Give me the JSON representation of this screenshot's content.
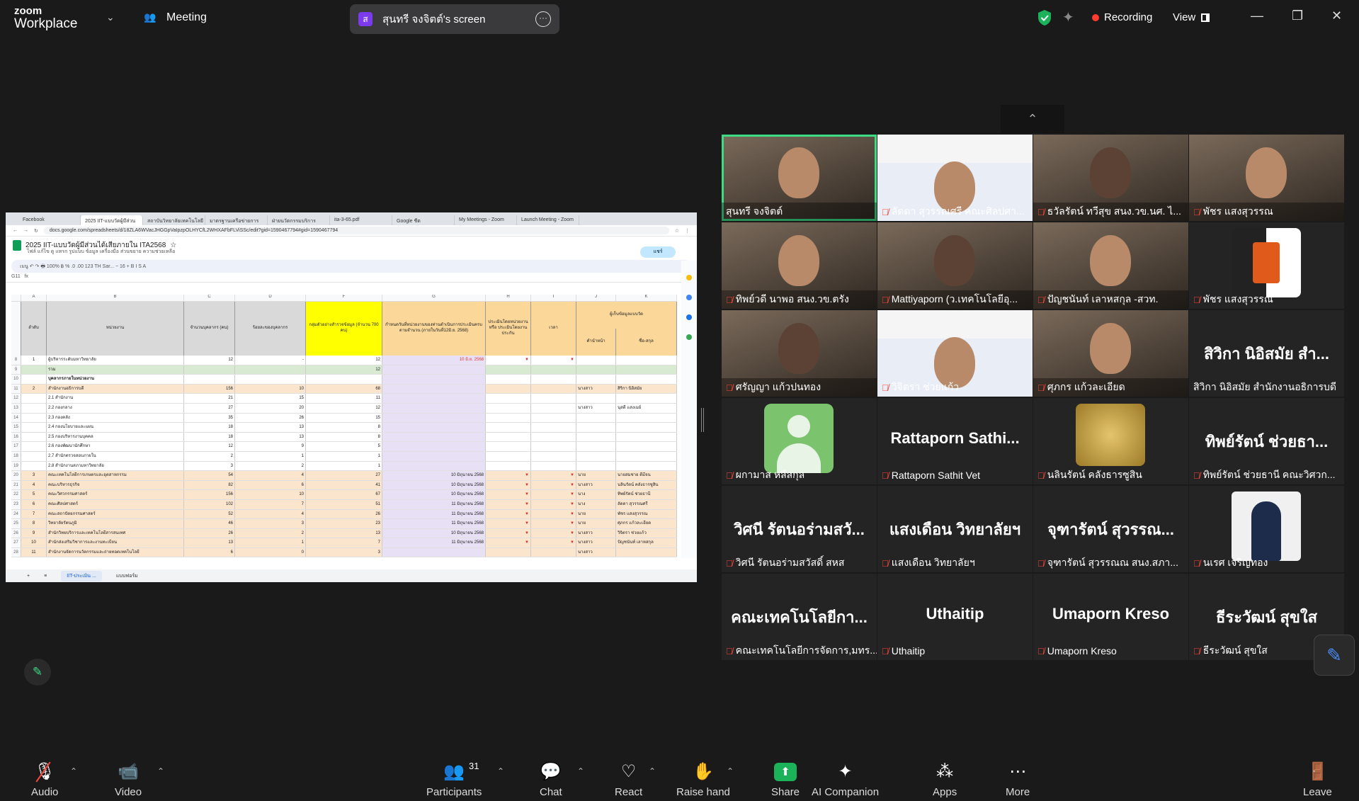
{
  "app": {
    "brand_top": "zoom",
    "brand_bottom": "Workplace",
    "meeting_label": "Meeting"
  },
  "screen_share": {
    "avatar_letter": "ส",
    "label": "สุนทรี จงจิตต์'s screen"
  },
  "status": {
    "recording": "Recording",
    "view": "View",
    "colors": {
      "recording": "#ff3b30",
      "shield": "#1cb25a",
      "active_speaker": "#3ddc84"
    }
  },
  "browser": {
    "tabs": [
      "Facebook",
      "2025 IIT-แบบวัดผู้มีส่วน",
      "สถาบันวิทยาลัยเทคโนโลยี",
      "มาตรฐานเครือข่ายการ",
      "ฝ่ายนวัตกรรมบริการ",
      "ita-3-65.pdf",
      "Google ชีต",
      "My Meetings - Zoom",
      "Launch Meeting - Zoom"
    ],
    "url": "docs.google.com/spreadsheets/d/18ZLA6WVacJHGGpVaIpzpOLHYCfL2WHXAFbFLViSSc/edit?gid=1590467794#gid=1590467794"
  },
  "sheet": {
    "title": "2025 IIT-แบบวัดผู้มีส่วนได้เสียภายใน ITA2568",
    "menu": "ไฟล์  แก้ไข  ดู  แทรก  รูปแบบ  ข้อมูล  เครื่องมือ  ส่วนขยาย  ความช่วยเหลือ",
    "share_label": "แชร์",
    "toolbar_text": "เมนู  ↶  ↷  🖶  100%  ฿  %  .0  .00  123  TH Sar...  −  16  +  B  I  S  A",
    "cell_ref": "G11",
    "headers": {
      "a": "ลำดับ",
      "b": "หน่วยงาน",
      "c": "จำนวนบุคลากร (คน)",
      "d": "ร้อยละของบุคลากร",
      "f": "กลุ่มตัวอย่างสำรวจข้อมูล (จำนวน 700 คน)",
      "g": "กำหนดวันที่หน่วยงานของท่านดำเนินการประเมินครบตามจำนวน (ภายในวันที่12มิ.ย. 2568)",
      "h": "ประเมินโดยหน่วยงาน หรือ ประเมินโดยงานประกัน",
      "i": "เวลา",
      "j": "คำนำหน้า",
      "k": "ชื่อ-สกุล",
      "k_group": "ผู้เก็บข้อมูลแบบวัด"
    },
    "rows": [
      {
        "rn": "8",
        "a": "1",
        "b": "ผู้บริหารระดับมหาวิทยาลัย",
        "c": "12",
        "d": "-",
        "f": "12",
        "g": "10 มิ.ย. 2568",
        "j": "",
        "k": "",
        "fill": "#ffffff"
      },
      {
        "rn": "9",
        "a": "",
        "b": "รวม",
        "c": "",
        "d": "",
        "f": "12",
        "g": "",
        "j": "",
        "k": "",
        "fill": "#d9ead3"
      },
      {
        "rn": "10",
        "a": "",
        "b": "บุคลากรภายในหน่วยงาน",
        "c": "",
        "d": "",
        "f": "",
        "g": "",
        "j": "",
        "k": "",
        "fill": "#ffffff"
      },
      {
        "rn": "11",
        "a": "2",
        "b": "สำนักงานอธิการบดี",
        "c": "156",
        "d": "10",
        "f": "68",
        "g": "",
        "j": "นางสาว",
        "k": "สิริกา นิอิสมัย",
        "fill": "#fce5cd"
      },
      {
        "rn": "12",
        "a": "",
        "b": "2.1 สำนักงาน",
        "c": "21",
        "d": "15",
        "f": "11",
        "g": "",
        "j": "",
        "k": "",
        "fill": "#ffffff"
      },
      {
        "rn": "13",
        "a": "",
        "b": "2.2 กองกลาง",
        "c": "27",
        "d": "20",
        "f": "12",
        "g": "",
        "j": "นางสาว",
        "k": "นุสดี แสงเมย์",
        "fill": "#ffffff"
      },
      {
        "rn": "14",
        "a": "",
        "b": "2.3 กองคลัง",
        "c": "35",
        "d": "26",
        "f": "15",
        "g": "",
        "j": "",
        "k": "",
        "fill": "#ffffff"
      },
      {
        "rn": "15",
        "a": "",
        "b": "2.4 กองนโยบายและแผน",
        "c": "18",
        "d": "13",
        "f": "8",
        "g": "",
        "j": "",
        "k": "",
        "fill": "#ffffff"
      },
      {
        "rn": "16",
        "a": "",
        "b": "2.5 กองบริหารงานบุคคล",
        "c": "18",
        "d": "13",
        "f": "8",
        "g": "",
        "j": "",
        "k": "",
        "fill": "#ffffff"
      },
      {
        "rn": "17",
        "a": "",
        "b": "2.6 กองพัฒนานักศึกษา",
        "c": "12",
        "d": "9",
        "f": "5",
        "g": "",
        "j": "",
        "k": "",
        "fill": "#ffffff"
      },
      {
        "rn": "18",
        "a": "",
        "b": "2.7 สำนักตรวจสอบภายใน",
        "c": "2",
        "d": "1",
        "f": "1",
        "g": "",
        "j": "",
        "k": "",
        "fill": "#ffffff"
      },
      {
        "rn": "19",
        "a": "",
        "b": "2.8 สำนักงานสภามหาวิทยาลัย",
        "c": "3",
        "d": "2",
        "f": "1",
        "g": "",
        "j": "",
        "k": "",
        "fill": "#ffffff"
      },
      {
        "rn": "20",
        "a": "3",
        "b": "คณะเทคโนโลยีการเกษตรและอุตสาหกรรม",
        "c": "54",
        "d": "4",
        "f": "27",
        "g": "10 มิถุนายน 2568",
        "j": "นาย",
        "k": "นายสมชาย ดีมีจน",
        "fill": "#fce5cd"
      },
      {
        "rn": "21",
        "a": "4",
        "b": "คณะบริหารธุรกิจ",
        "c": "82",
        "d": "6",
        "f": "41",
        "g": "10 มิถุนายน 2568",
        "j": "นางสาว",
        "k": "นลินรัตน์ คลังธารซูสิน",
        "fill": "#fce5cd"
      },
      {
        "rn": "22",
        "a": "5",
        "b": "คณะวิศวกรรมศาสตร์",
        "c": "156",
        "d": "10",
        "f": "67",
        "g": "10 มิถุนายน 2568",
        "j": "นาง",
        "k": "ทิพย์รัตน์ ช่วยธานี",
        "fill": "#fce5cd"
      },
      {
        "rn": "23",
        "a": "6",
        "b": "คณะศิลปศาสตร์",
        "c": "102",
        "d": "7",
        "f": "51",
        "g": "11 มิถุนายน 2568",
        "j": "นาง",
        "k": "ลัดดา สุวรรณศรี",
        "fill": "#fce5cd"
      },
      {
        "rn": "24",
        "a": "7",
        "b": "คณะสถาปัตยกรรมศาสตร์",
        "c": "52",
        "d": "4",
        "f": "26",
        "g": "11 มิถุนายน 2568",
        "j": "นาย",
        "k": "พัชร แสงสุวรรณ",
        "fill": "#fce5cd"
      },
      {
        "rn": "25",
        "a": "8",
        "b": "วิทยาลัยรัตนภูมิ",
        "c": "46",
        "d": "3",
        "f": "23",
        "g": "11 มิถุนายน 2568",
        "j": "นาย",
        "k": "ศุภกร แก้วละเอียด",
        "fill": "#fce5cd"
      },
      {
        "rn": "26",
        "a": "9",
        "b": "สำนักวิทยบริการและเทคโนโลยีสารสนเทศ",
        "c": "26",
        "d": "2",
        "f": "13",
        "g": "10 มิถุนายน 2568",
        "j": "นางสาว",
        "k": "วิจิตรา ช่วยแก้ว",
        "fill": "#fce5cd"
      },
      {
        "rn": "27",
        "a": "10",
        "b": "สำนักส่งเสริมวิชาการและงานทะเบียน",
        "c": "13",
        "d": "1",
        "f": "7",
        "g": "11 มิถุนายน 2568",
        "j": "นางสาว",
        "k": "ปัญชนันท์ เลาหสกุล",
        "fill": "#fce5cd"
      },
      {
        "rn": "28",
        "a": "11",
        "b": "สำนักงานจัดการนวัตกรรมและถ่ายทอดเทคโนโลยี",
        "c": "6",
        "d": "0",
        "f": "3",
        "g": "",
        "j": "นางสาว",
        "k": "",
        "fill": "#fce5cd"
      }
    ],
    "tabs": [
      "IIT-ประเมิน ...",
      "แบบฟอร์ม"
    ]
  },
  "participants": [
    {
      "big": "",
      "name": "สุนทรี จงจิตต์",
      "muted": false,
      "kind": "photo",
      "active": true
    },
    {
      "big": "",
      "name": "ลัดดา สุวรรณศรี คณะศิลปศา...",
      "muted": true,
      "kind": "banner"
    },
    {
      "big": "",
      "name": "ธวัลรัตน์ ทวีสุข สนง.วข.นศ. ไ...",
      "muted": true,
      "kind": "photo"
    },
    {
      "big": "",
      "name": "พัชร แสงสุวรรณ",
      "muted": true,
      "kind": "photo"
    },
    {
      "big": "",
      "name": "ทิพย์วดี นาพอ สนง.วข.ตรัง",
      "muted": true,
      "kind": "photo"
    },
    {
      "big": "",
      "name": "Mattiyaporn (ว.เทคโนโลยีอุ...",
      "muted": true,
      "kind": "photo"
    },
    {
      "big": "",
      "name": "ปัญชนันท์ เลาหสกุล -สวท.",
      "muted": true,
      "kind": "photo"
    },
    {
      "big": "",
      "name": "พัชร แสงสุวรรณ",
      "muted": true,
      "kind": "column"
    },
    {
      "big": "",
      "name": "ศรัญญา แก้วปนทอง",
      "muted": true,
      "kind": "photo"
    },
    {
      "big": "",
      "name": "วิจิตรา ช่วยแก้ว",
      "muted": true,
      "kind": "banner"
    },
    {
      "big": "",
      "name": "ศุภกร แก้วละเอียด",
      "muted": true,
      "kind": "photo"
    },
    {
      "big": "สิวิกา นิอิสมัย สำ...",
      "name": "สิวิกา นิอิสมัย สำนักงานอธิการบดี",
      "muted": false,
      "kind": "text"
    },
    {
      "big": "",
      "name": "ผกามาส หลีสกุล",
      "muted": true,
      "kind": "generic"
    },
    {
      "big": "Rattaporn Sathi...",
      "name": "Rattaporn Sathit Vet",
      "muted": true,
      "kind": "text"
    },
    {
      "big": "",
      "name": "นลินรัตน์ คลังธารซูสิน",
      "muted": true,
      "kind": "gold"
    },
    {
      "big": "ทิพย์รัตน์ ช่วยธา...",
      "name": "ทิพย์รัตน์ ช่วยธานี คณะวิศวก...",
      "muted": true,
      "kind": "text"
    },
    {
      "big": "วิศนี รัตนอร่ามสวั...",
      "name": "วิศนี รัตนอร่ามสวัสดิ์ สหส",
      "muted": true,
      "kind": "text"
    },
    {
      "big": "แสงเดือน วิทยาลัยฯ",
      "name": "แสงเดือน วิทยาลัยฯ",
      "muted": true,
      "kind": "text"
    },
    {
      "big": "จุฑารัตน์ สุวรรณ...",
      "name": "จุฑารัตน์ สุวรรณณ สนง.สภา...",
      "muted": true,
      "kind": "text"
    },
    {
      "big": "",
      "name": "นเรศ เจริญทอง",
      "muted": true,
      "kind": "man"
    },
    {
      "big": "คณะเทคโนโลยีกา...",
      "name": "คณะเทคโนโลยีการจัดการ,มทร...",
      "muted": true,
      "kind": "text"
    },
    {
      "big": "Uthaitip",
      "name": "Uthaitip",
      "muted": true,
      "kind": "text"
    },
    {
      "big": "Umaporn Kreso",
      "name": "Umaporn Kreso",
      "muted": true,
      "kind": "text"
    },
    {
      "big": "ธีระวัฒน์ สุขใส",
      "name": "ธีระวัฒน์ สุขใส",
      "muted": true,
      "kind": "text"
    }
  ],
  "toolbar": {
    "audio": "Audio",
    "video": "Video",
    "participants": "Participants",
    "participant_count": "31",
    "chat": "Chat",
    "react": "React",
    "raise_hand": "Raise hand",
    "share": "Share",
    "ai_companion": "AI Companion",
    "apps": "Apps",
    "more": "More",
    "leave": "Leave"
  }
}
